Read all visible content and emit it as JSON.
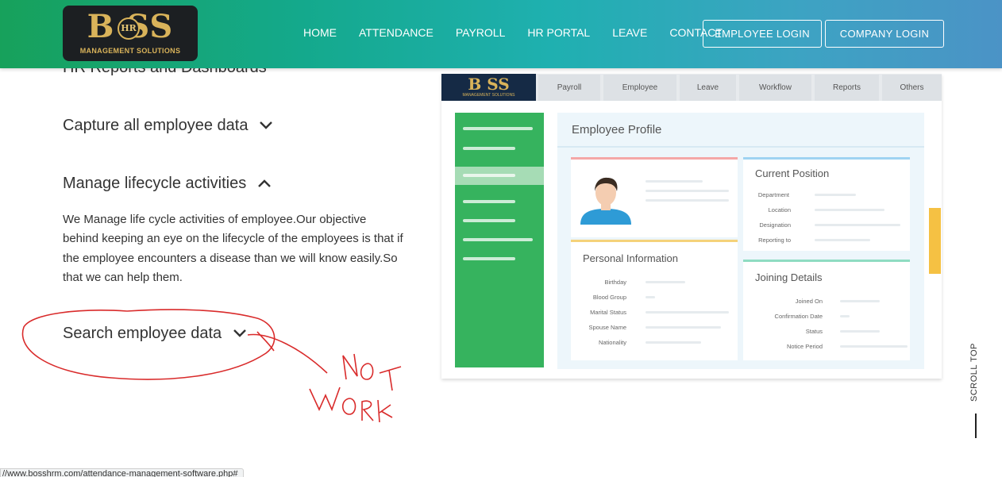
{
  "header": {
    "logo_word": "B SS",
    "logo_badge": "HR",
    "logo_sub": "MANAGEMENT SOLUTIONS",
    "nav": [
      "HOME",
      "ATTENDANCE",
      "PAYROLL",
      "HR PORTAL",
      "LEAVE",
      "CONTACT"
    ],
    "employee_login": "EMPLOYEE LOGIN",
    "company_login": "COMPANY LOGIN"
  },
  "content": {
    "partial_heading": "HR Reports and Dashboards",
    "accordion": [
      {
        "title": "Capture all employee data",
        "state": "collapsed"
      },
      {
        "title": "Manage lifecycle activities",
        "state": "expanded",
        "body": "We Manage life cycle activities of employee.Our objective behind keeping an eye on the lifecycle of the employees is that if the employee encounters a disease than we will know easily.So that we can help them."
      },
      {
        "title": "Search employee data",
        "state": "collapsed"
      }
    ],
    "annotation": "NOT WORK"
  },
  "illustration": {
    "logo_word": "B SS",
    "logo_sub": "MANAGEMENT SOLUTIONS",
    "tabs": [
      "Payroll",
      "Employee",
      "Leave",
      "Workflow",
      "Reports",
      "Others"
    ],
    "title": "Employee Profile",
    "current_position": {
      "label": "Current Position",
      "fields": [
        "Department",
        "Location",
        "Designation",
        "Reporting to"
      ]
    },
    "personal_information": {
      "label": "Personal Information",
      "fields": [
        "Birthday",
        "Blood Group",
        "Marital Status",
        "Spouse Name",
        "Nationality"
      ]
    },
    "joining_details": {
      "label": "Joining Details",
      "fields": [
        "Joined On",
        "Confirmation Date",
        "Status",
        "Notice Period"
      ]
    },
    "colors": {
      "sidebar": "#36b35e",
      "profile_border": "#f4a7a7",
      "position_border": "#9fd3f2",
      "personal_border": "#f5d27a",
      "joining_border": "#8fdcc2",
      "side_tab": "#f5c143"
    }
  },
  "scroll_top": "SCROLL TOP",
  "status_url": "//www.bosshrm.com/attendance-management-software.php#"
}
